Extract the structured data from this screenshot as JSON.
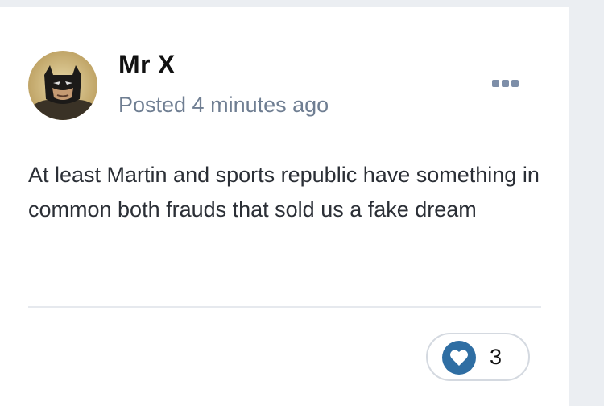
{
  "post": {
    "author": "Mr X",
    "meta": "Posted 4 minutes ago",
    "content": "At least Martin and sports republic have something in common both frauds that sold us a fake dream",
    "reaction_count": "3"
  },
  "icons": {
    "avatar": "batman-avatar",
    "more": "ellipsis-menu-icon",
    "reaction": "heart-icon"
  },
  "colors": {
    "accent": "#2f6ea3",
    "meta_text": "#6f7e92"
  }
}
